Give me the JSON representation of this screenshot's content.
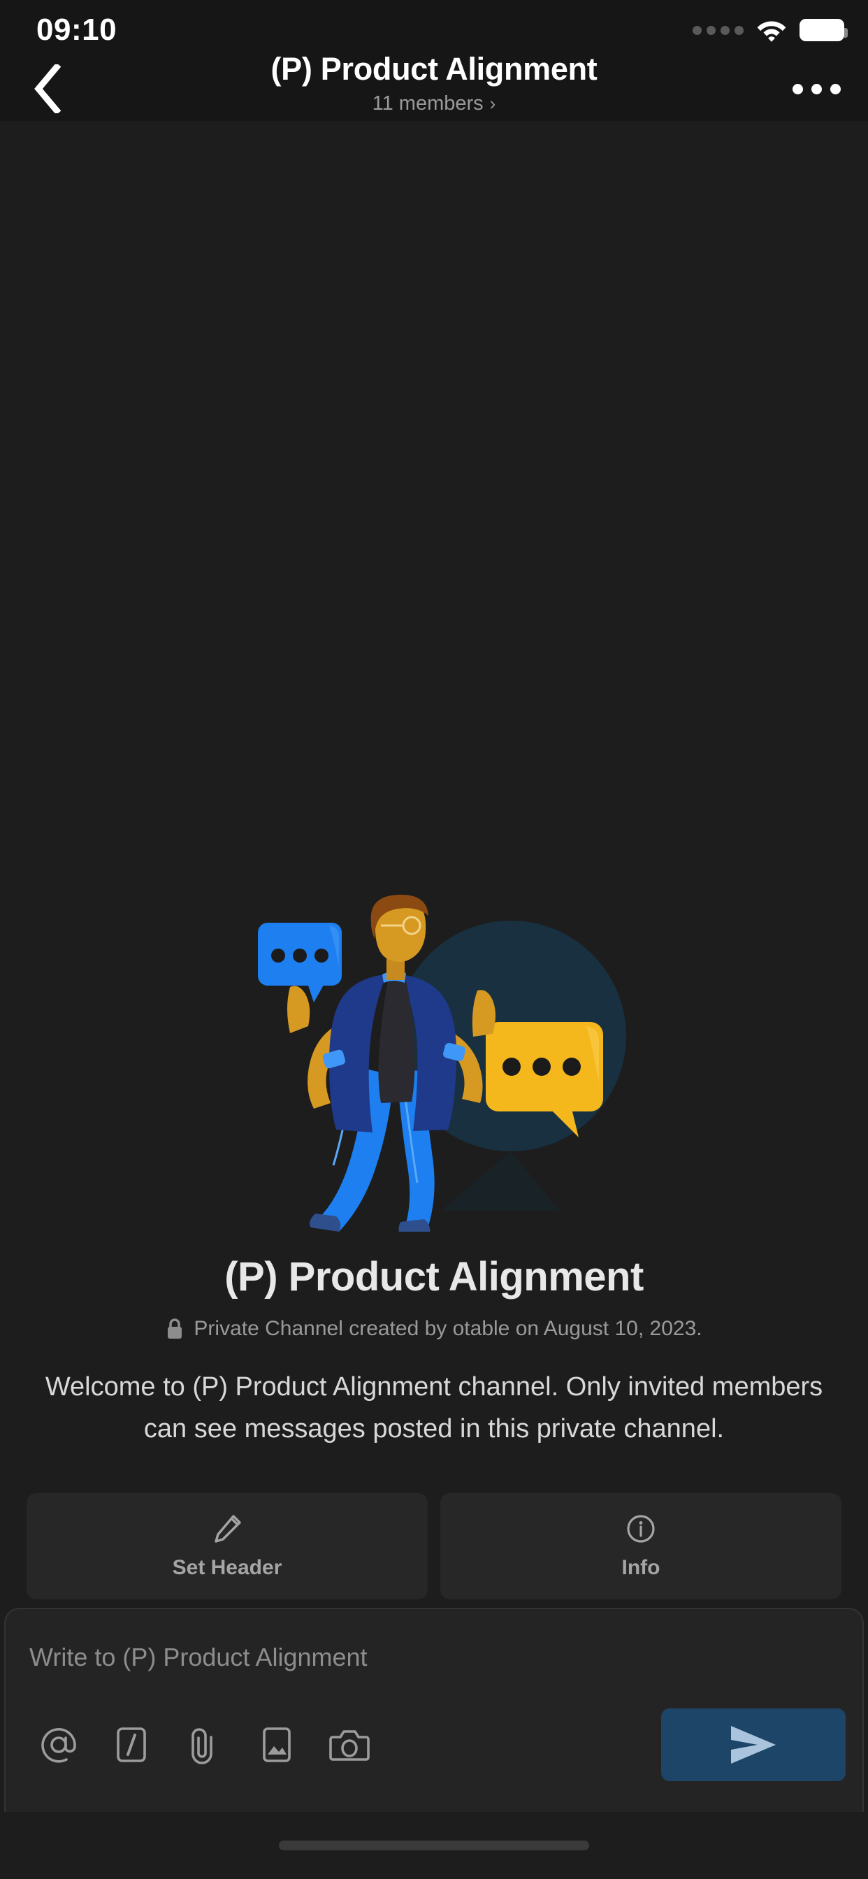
{
  "status_bar": {
    "time": "09:10",
    "signal_icon": "signal-dots-icon",
    "wifi_icon": "wifi-icon",
    "battery_icon": "battery-full-icon"
  },
  "nav_bar": {
    "back_icon": "chevron-left-icon",
    "title": "(P) Product Alignment",
    "subtitle": "11 members",
    "subtitle_chevron": "›",
    "more_icon": "more-horizontal-icon"
  },
  "intro": {
    "illustration_name": "person-with-chat-bubbles-illustration",
    "channel_title": "(P) Product Alignment",
    "lock_icon": "lock-icon",
    "meta": "Private Channel  created by otable on August 10, 2023.",
    "welcome": "Welcome to (P) Product Alignment channel. Only invited members can see messages posted in this private channel."
  },
  "actions": [
    {
      "label": "Set Header",
      "icon": "pencil-icon"
    },
    {
      "label": "Info",
      "icon": "info-circle-icon"
    }
  ],
  "composer": {
    "placeholder": "Write to (P) Product Alignment",
    "value": "",
    "tools": [
      {
        "icon": "at-mention-icon"
      },
      {
        "icon": "slash-command-icon"
      },
      {
        "icon": "paperclip-icon"
      },
      {
        "icon": "image-icon"
      },
      {
        "icon": "camera-icon"
      }
    ],
    "send_icon": "send-plane-icon"
  },
  "colors": {
    "background": "#1d1d1d",
    "header_background": "#161616",
    "composer_background": "#242424",
    "action_background": "#272727",
    "send_button": "#1d4568",
    "accent_blue": "#1d7ff0",
    "accent_yellow": "#f5b81c",
    "title_text": "#e8e8e8",
    "muted_text": "#9a9a9a"
  }
}
